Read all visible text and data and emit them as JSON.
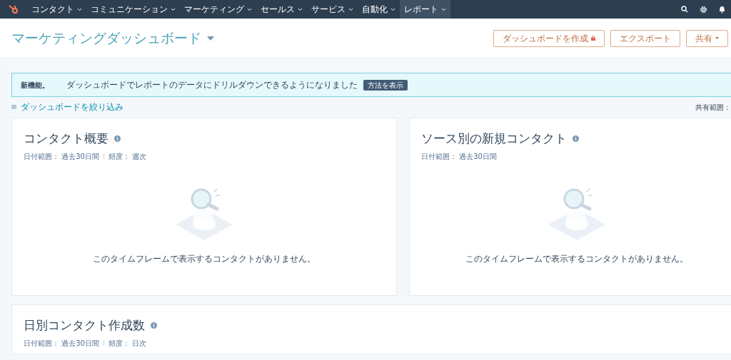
{
  "nav": {
    "items": [
      {
        "label": "コンタクト",
        "selected": false
      },
      {
        "label": "コミュニケーション",
        "selected": false
      },
      {
        "label": "マーケティング",
        "selected": false
      },
      {
        "label": "セールス",
        "selected": false
      },
      {
        "label": "サービス",
        "selected": false
      },
      {
        "label": "自動化",
        "selected": false
      },
      {
        "label": "レポート",
        "selected": true
      }
    ]
  },
  "header": {
    "title": "マーケティングダッシュボード",
    "buttons": [
      {
        "label": "ダッシュボードを作成",
        "locked": true,
        "dropdown": false
      },
      {
        "label": "エクスポート",
        "locked": false,
        "dropdown": false
      },
      {
        "label": "共有",
        "locked": false,
        "dropdown": true
      }
    ]
  },
  "banner": {
    "title": "新機能。",
    "message": "ダッシュボードでレポートのデータにドリルダウンできるようになりました",
    "button": "方法を表示"
  },
  "filter_link": "ダッシュボードを絞り込み",
  "share_scope": "共有範囲：",
  "cards": [
    {
      "title": "コンタクト概要",
      "meta": [
        "日付範囲： 過去30日間",
        "頻度： 週次"
      ],
      "empty_message": "このタイムフレームで表示するコンタクトがありません。"
    },
    {
      "title": "ソース別の新規コンタクト",
      "meta": [
        "日付範囲： 過去30日間"
      ],
      "empty_message": "このタイムフレームで表示するコンタクトがありません。"
    },
    {
      "title": "日別コンタクト作成数",
      "meta": [
        "日付範囲： 過去30日間",
        "頻度： 日次"
      ]
    }
  ]
}
